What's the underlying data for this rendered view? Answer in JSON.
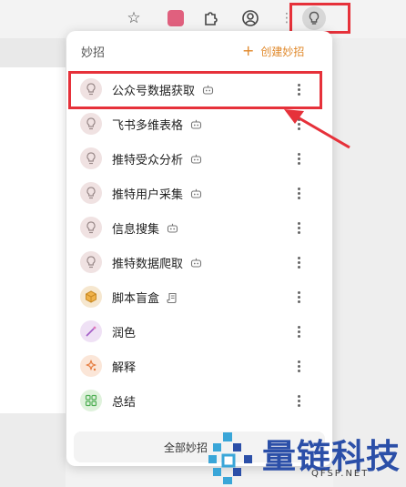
{
  "toolbar": {
    "icons": [
      "star-icon",
      "extension-pink-icon",
      "puzzle-icon",
      "profile-icon",
      "more-vertical-icon",
      "lightbulb-icon"
    ]
  },
  "panel": {
    "title": "妙招",
    "create_label": "创建妙招",
    "footer_label": "全部妙招",
    "items": [
      {
        "label": "公众号数据获取",
        "icon": "lightbulb-icon",
        "badge": "bot-icon"
      },
      {
        "label": "飞书多维表格",
        "icon": "lightbulb-icon",
        "badge": "bot-icon"
      },
      {
        "label": "推特受众分析",
        "icon": "lightbulb-icon",
        "badge": "bot-icon"
      },
      {
        "label": "推特用户采集",
        "icon": "lightbulb-icon",
        "badge": "bot-icon"
      },
      {
        "label": "信息搜集",
        "icon": "lightbulb-icon",
        "badge": "bot-icon"
      },
      {
        "label": "推特数据爬取",
        "icon": "lightbulb-icon",
        "badge": "bot-icon"
      },
      {
        "label": "脚本盲盒",
        "icon": "box-icon",
        "badge": "script-icon"
      },
      {
        "label": "润色",
        "icon": "magic-wand-icon",
        "badge": ""
      },
      {
        "label": "解释",
        "icon": "sparkle-icon",
        "badge": ""
      },
      {
        "label": "总结",
        "icon": "grid-icon",
        "badge": ""
      }
    ]
  },
  "watermark": {
    "text": "量链科技",
    "url": "QFSP.NET"
  },
  "colors": {
    "accent": "#e0882a",
    "highlight": "#e6313a",
    "watermark": "#2b4fa8"
  }
}
